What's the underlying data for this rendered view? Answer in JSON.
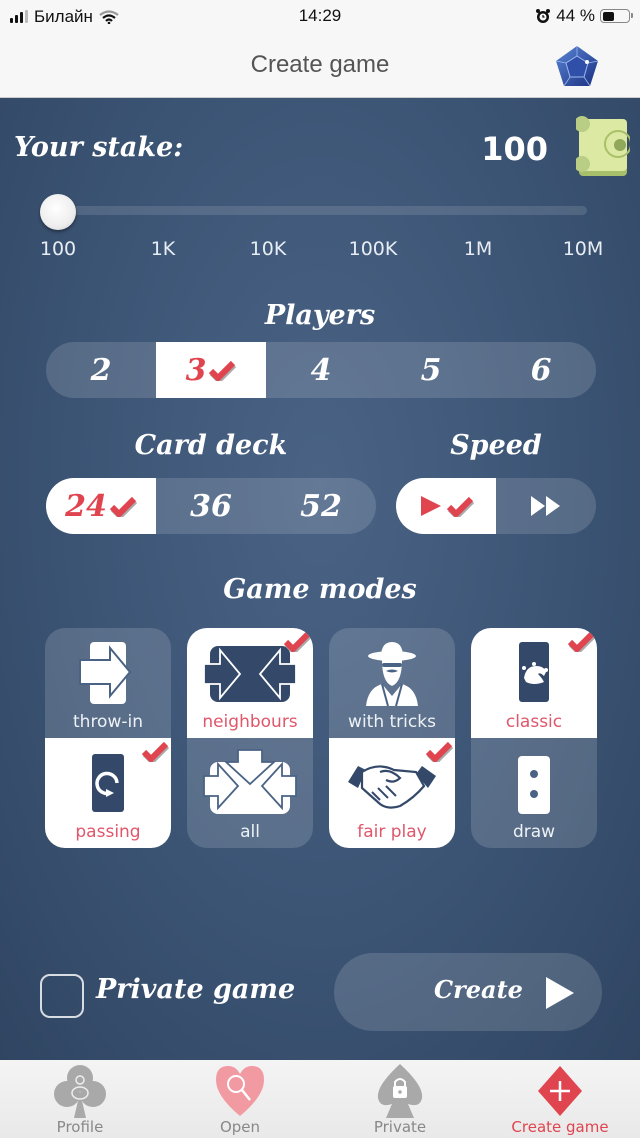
{
  "status_bar": {
    "carrier": "Билайн",
    "time": "14:29",
    "battery": "44 %",
    "battery_level": 0.44,
    "icons": [
      "signal-icon",
      "wifi-icon",
      "alarm-icon",
      "battery-icon"
    ]
  },
  "header": {
    "title": "Create game",
    "right_icon": "gem-icon"
  },
  "stake": {
    "label": "Your stake:",
    "value": "100",
    "icon": "money-icon",
    "slider_position": 0,
    "ticks": [
      "100",
      "1K",
      "10K",
      "100K",
      "1M",
      "10M"
    ]
  },
  "players": {
    "title": "Players",
    "options": [
      "2",
      "3",
      "4",
      "5",
      "6"
    ],
    "selected": "3"
  },
  "card_deck": {
    "title": "Card deck",
    "options": [
      "24",
      "36",
      "52"
    ],
    "selected": "24"
  },
  "speed": {
    "title": "Speed",
    "options": [
      "normal",
      "fast"
    ],
    "selected": "normal"
  },
  "game_modes": {
    "title": "Game modes",
    "columns": [
      {
        "top": {
          "label": "throw-in",
          "selected": false,
          "icon": "throw-in-icon"
        },
        "bottom": {
          "label": "passing",
          "selected": true,
          "icon": "passing-icon"
        }
      },
      {
        "top": {
          "label": "neighbours",
          "selected": true,
          "icon": "neighbours-icon"
        },
        "bottom": {
          "label": "all",
          "selected": false,
          "icon": "all-icon"
        }
      },
      {
        "top": {
          "label": "with tricks",
          "selected": false,
          "icon": "cheater-icon"
        },
        "bottom": {
          "label": "fair play",
          "selected": true,
          "icon": "handshake-icon"
        }
      },
      {
        "top": {
          "label": "classic",
          "selected": true,
          "icon": "joker-card-icon"
        },
        "bottom": {
          "label": "draw",
          "selected": false,
          "icon": "domino-icon"
        }
      }
    ]
  },
  "private_game": {
    "label": "Private game",
    "checked": false
  },
  "create_button": {
    "label": "Create"
  },
  "tabbar": {
    "tabs": [
      {
        "label": "Profile",
        "icon": "club-profile-icon",
        "active": false
      },
      {
        "label": "Open",
        "icon": "heart-search-icon",
        "active": false
      },
      {
        "label": "Private",
        "icon": "spade-lock-icon",
        "active": false
      },
      {
        "label": "Create game",
        "icon": "diamond-plus-icon",
        "active": true
      }
    ]
  },
  "colors": {
    "accent": "#e0444e",
    "background": "#3c5474",
    "selected_label": "#e0566a"
  }
}
